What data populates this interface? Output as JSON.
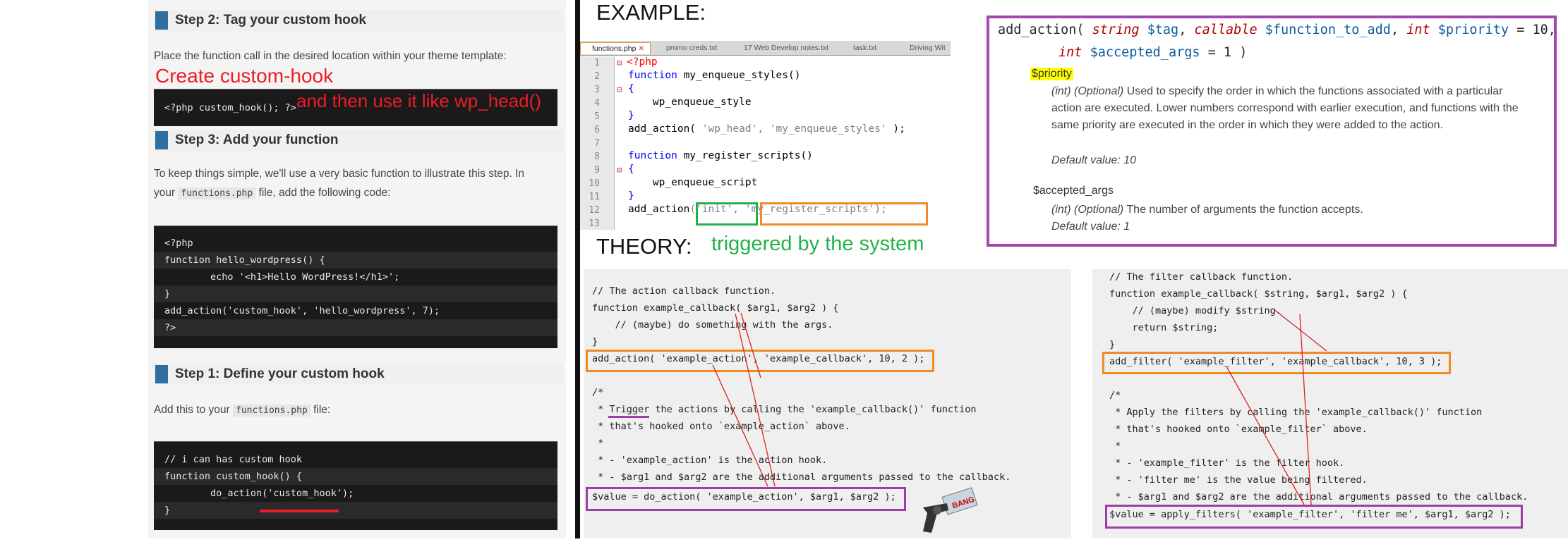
{
  "tutorial": {
    "step2": {
      "title": "Step 2: Tag your custom hook",
      "desc": "Place the function call in the desired location within your theme template:",
      "code": [
        "<?php custom_hook(); ?>"
      ]
    },
    "step3": {
      "title": "Step 3: Add your function",
      "desc_line1": "To keep things simple, we'll use a very basic function to illustrate this step. In",
      "desc_line2_pre": "your",
      "desc_line2_code": "functions.php",
      "desc_line2_post": "file, add the following code:",
      "code": [
        "<?php",
        "function hello_wordpress() {",
        "        echo '<h1>Hello WordPress!</h1>';",
        "}",
        "add_action('custom_hook', 'hello_wordpress', 7);",
        "?>"
      ]
    },
    "step1": {
      "title": "Step 1: Define your custom hook",
      "desc_pre": "Add this to your",
      "desc_code": "functions.php",
      "desc_post": "file:",
      "code": [
        "// i can has custom hook",
        "function custom_hook() {",
        "        do_action('custom_hook');",
        "}"
      ]
    },
    "annotations": {
      "create": "Create custom-hook",
      "use": "and then use it like wp_head()"
    }
  },
  "example": {
    "heading": "EXAMPLE:",
    "tabs": [
      "functions.php",
      "promo creds.txt",
      "17 Web Develop notes.txt",
      "task.txt",
      "Driving Wit"
    ],
    "line_numbers": [
      "1",
      "2",
      "3",
      "4",
      "5",
      "6",
      "7",
      "8",
      "9",
      "10",
      "11",
      "12",
      "13"
    ],
    "code": {
      "l1": "<?php",
      "l2_kw": "function",
      "l2_rest": " my_enqueue_styles()",
      "l3": "{",
      "l4": "    wp_enqueue_style",
      "l5": "}",
      "l6_fn": "add_action(",
      "l6_s1": " 'wp_head',",
      "l6_s2": " 'my_enqueue_styles'",
      "l6_end": " );",
      "l8_kw": "function",
      "l8_rest": " my_register_scripts()",
      "l9": "{",
      "l10": "    wp_enqueue_script",
      "l11": "}",
      "l12_fn": "add_action",
      "l12_s1": "('init',",
      "l12_s2": "'my_register_scripts');"
    }
  },
  "docs": {
    "sig_line1": {
      "fn": "add_action(",
      "t1": "string",
      "v1": "$tag",
      "t2": "callable",
      "v2": "$function_to_add",
      "t3": "int",
      "v3": "$priority",
      "d3": "= 10,"
    },
    "sig_line2": {
      "t": "int",
      "v": "$accepted_args",
      "d": "= 1 )"
    },
    "priority": {
      "label": "$priority",
      "opt": "(int) (Optional)",
      "text": "Used to specify the order in which the functions associated with a particular action are executed. Lower numbers correspond with earlier execution, and functions with the same priority are executed in the order in which they were added to the action.",
      "default": "Default value: 10"
    },
    "accepted": {
      "label": "$accepted_args",
      "opt": "(int) (Optional)",
      "text": "The number of arguments the function accepts.",
      "default": "Default value: 1"
    }
  },
  "theory": {
    "heading": "THEORY:",
    "note": "triggered by the system",
    "action": [
      "// The action callback function.",
      "function example_callback( $arg1, $arg2 ) {",
      "    // (maybe) do something with the args.",
      "}",
      "add_action( 'example_action', 'example_callback', 10, 2 );",
      "",
      "/*",
      " * Trigger the actions by calling the 'example_callback()' function",
      " * that's hooked onto `example_action` above.",
      " *",
      " * - 'example_action' is the action hook.",
      " * - $arg1 and $arg2 are the additional arguments passed to the callback.",
      "$value = do_action( 'example_action', $arg1, $arg2 );"
    ],
    "filter": [
      "// The filter callback function.",
      "function example_callback( $string, $arg1, $arg2 ) {",
      "    // (maybe) modify $string.",
      "    return $string;",
      "}",
      "add_filter( 'example_filter', 'example_callback', 10, 3 );",
      "",
      "/*",
      " * Apply the filters by calling the 'example_callback()' function",
      " * that's hooked onto `example_filter` above.",
      " *",
      " * - 'example_filter' is the filter hook.",
      " * - 'filter me' is the value being filtered.",
      " * - $arg1 and $arg2 are the additional arguments passed to the callback.",
      "$value = apply_filters( 'example_filter', 'filter me', $arg1, $arg2 );"
    ]
  },
  "colors": {
    "accent_blue": "#2f6f9d",
    "annot_red": "#ee1c24",
    "annot_green": "#22b14c",
    "box_orange": "#f08a24",
    "box_purple": "#9b3fa6"
  }
}
